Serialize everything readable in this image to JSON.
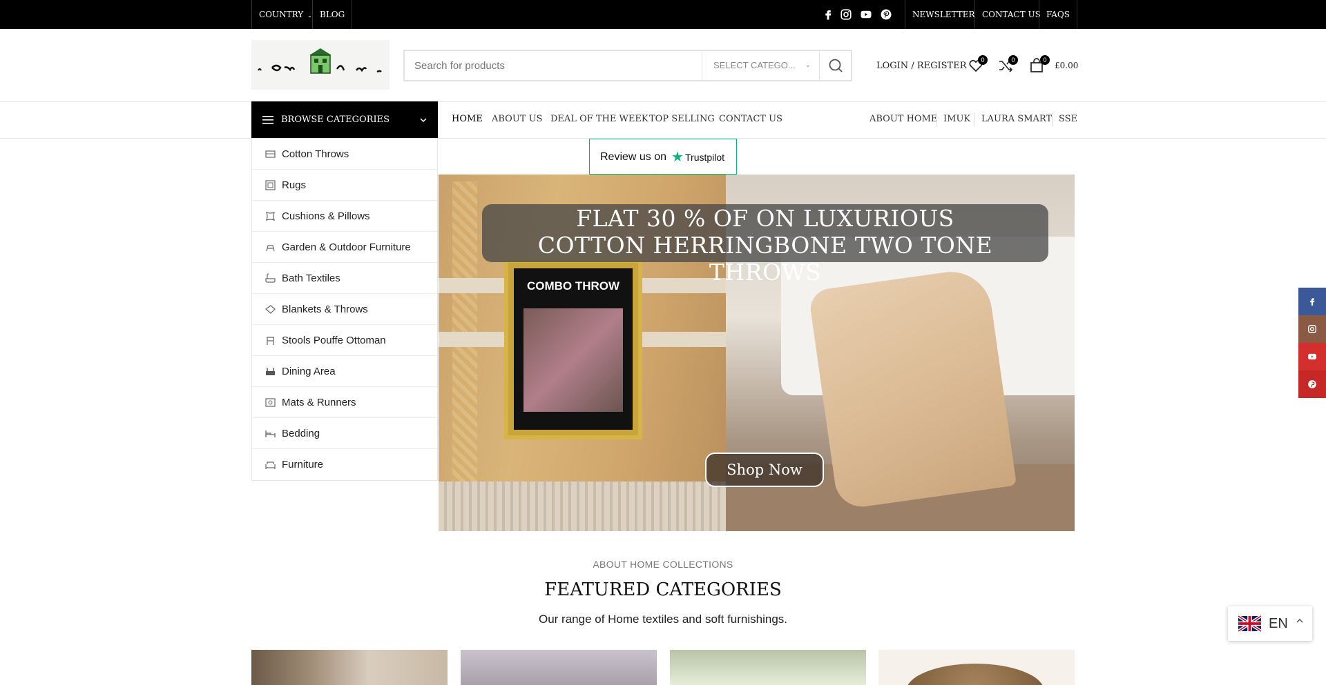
{
  "topbar": {
    "country": "COUNTRY",
    "blog": "BLOG",
    "newsletter": "NEWSLETTER",
    "contact": "CONTACT US",
    "faqs": "FAQS",
    "social_icons": [
      "facebook-icon",
      "instagram-icon",
      "youtube-icon",
      "pinterest-icon"
    ]
  },
  "header": {
    "search_placeholder": "Search for products",
    "select_category": "SELECT CATEGO...",
    "login": "LOGIN / REGISTER",
    "wishlist_count": "0",
    "compare_count": "0",
    "cart_count": "0",
    "cart_total": "£0.00"
  },
  "nav": {
    "browse_label": "BROWSE CATEGORIES",
    "links": [
      "HOME",
      "ABOUT US",
      "DEAL OF THE WEEK",
      "TOP SELLING",
      "CONTACT US"
    ],
    "right_links": [
      "ABOUT HOME",
      "IMUK",
      "LAURA SMART",
      "SSE"
    ]
  },
  "categories": [
    "Cotton Throws",
    "Rugs",
    "Cushions & Pillows",
    "Garden & Outdoor Furniture",
    "Bath Textiles",
    "Blankets & Throws",
    "Stools Pouffe Ottoman",
    "Dining Area",
    "Mats & Runners",
    "Bedding",
    "Furniture"
  ],
  "trustpilot": {
    "review_text": "Review us on",
    "brand": "Trustpilot"
  },
  "hero": {
    "line1": "FLAT 30 % OF ON LUXURIOUS",
    "line2": "COTTON HERRINGBONE TWO TONE THROWS",
    "button": "Shop Now",
    "package_title": "COMBO THROW"
  },
  "featured": {
    "subtitle": "ABOUT HOME COLLECTIONS",
    "title": "FEATURED CATEGORIES",
    "description": "Our range of Home textiles and soft furnishings."
  },
  "language": {
    "code": "EN"
  },
  "colors": {
    "topbar_bg": "#000000",
    "trustpilot_green": "#00b67a",
    "facebook": "#3b5998",
    "instagram": "#8a5a44",
    "youtube": "#d32f2f",
    "pinterest": "#c62828"
  }
}
